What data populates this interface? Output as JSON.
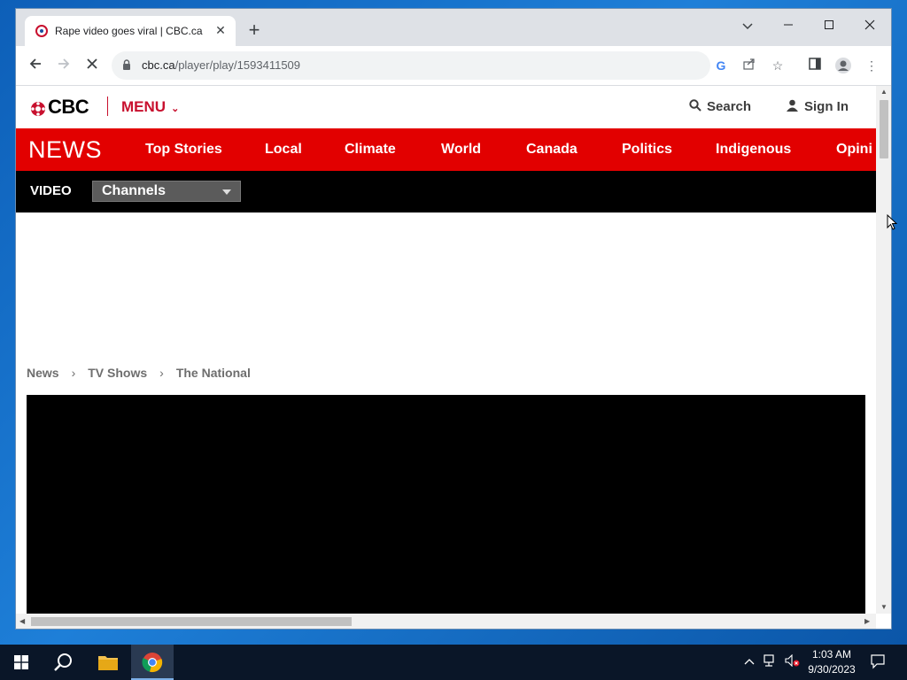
{
  "browser": {
    "tab_title": "Rape video goes viral | CBC.ca",
    "url_host": "cbc.ca",
    "url_path": "/player/play/1593411509"
  },
  "cbc": {
    "logo": "CBC",
    "menu_label": "MENU",
    "search_label": "Search",
    "signin_label": "Sign In",
    "news_label": "NEWS",
    "nav_items": [
      "Top Stories",
      "Local",
      "Climate",
      "World",
      "Canada",
      "Politics",
      "Indigenous",
      "Opini"
    ],
    "video_label": "VIDEO",
    "channels_label": "Channels",
    "breadcrumb": [
      "News",
      "TV Shows",
      "The National"
    ]
  },
  "colors": {
    "cbc_red": "#e20000",
    "brand_red": "#c8102e"
  },
  "taskbar": {
    "time": "1:03 AM",
    "date": "9/30/2023"
  }
}
